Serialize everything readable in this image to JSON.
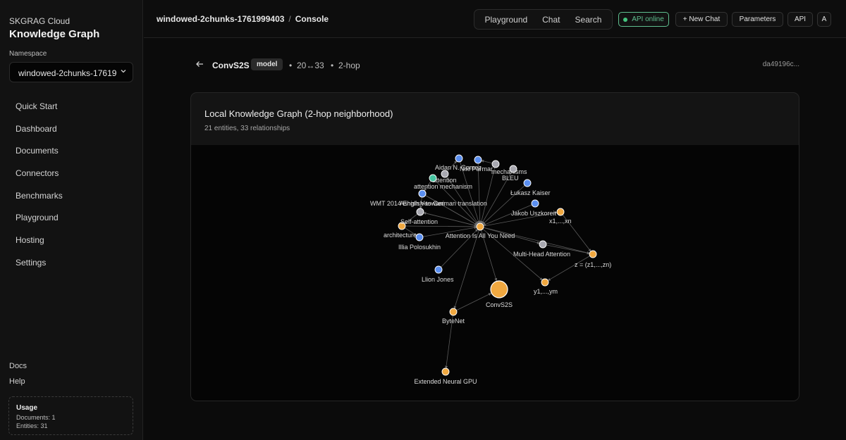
{
  "sidebar": {
    "brand_sub": "SKGRAG Cloud",
    "brand_title": "Knowledge Graph",
    "namespace_label": "Namespace",
    "namespace_value": "windowed-2chunks-1761999403",
    "nav": [
      "Quick Start",
      "Dashboard",
      "Documents",
      "Connectors",
      "Benchmarks",
      "Playground",
      "Hosting",
      "Settings"
    ],
    "footer_links": [
      "Docs",
      "Help"
    ],
    "usage": {
      "title": "Usage",
      "documents": "Documents: 1",
      "entities": "Entities: 31"
    }
  },
  "header": {
    "crumb_namespace": "windowed-2chunks-1761999403",
    "crumb_sep": "/",
    "crumb_page": "Console",
    "modes": [
      "Playground",
      "Chat",
      "Search"
    ],
    "api_status": "API online",
    "new_chat": "+ New Chat",
    "parameters": "Parameters",
    "api": "API",
    "avatar": "A",
    "status_color": "#45c47f"
  },
  "entity": {
    "name": "ConvS2S",
    "type_badge": "model",
    "counts": "20↔33",
    "hops": "2-hop",
    "id_short": "da49196c..."
  },
  "graph_card": {
    "title": "Local Knowledge Graph (2-hop neighborhood)",
    "subtitle": "21 entities, 33 relationships"
  },
  "graph": {
    "colors": {
      "orange": "#f0a840",
      "blue": "#5b8ff0",
      "gray": "#a8a8b0",
      "teal": "#45c4a0"
    },
    "nodes": [
      {
        "id": "attn",
        "label": "Attention Is All You Need",
        "color": "orange"
      },
      {
        "id": "conv",
        "label": "ConvS2S",
        "color": "orange",
        "focus": true
      },
      {
        "id": "bytenet",
        "label": "ByteNet",
        "color": "orange"
      },
      {
        "id": "engpu",
        "label": "Extended Neural GPU",
        "color": "orange"
      },
      {
        "id": "arch",
        "label": "architectures",
        "color": "orange"
      },
      {
        "id": "x1",
        "label": "x1,...,xn",
        "color": "orange"
      },
      {
        "id": "z",
        "label": "z = (z1,...,zn)",
        "color": "orange"
      },
      {
        "id": "y1",
        "label": "y1,...,ym",
        "color": "orange"
      },
      {
        "id": "mha",
        "label": "Multi-Head Attention",
        "color": "gray"
      },
      {
        "id": "selfatt",
        "label": "Self-attention",
        "color": "gray"
      },
      {
        "id": "mech",
        "label": "mechanisms",
        "color": "gray"
      },
      {
        "id": "attention",
        "label": "attention",
        "color": "gray"
      },
      {
        "id": "bleu",
        "label": "BLEU",
        "color": "gray"
      },
      {
        "id": "aidan",
        "label": "Aidan N. Gomez",
        "color": "blue"
      },
      {
        "id": "niki",
        "label": "Niki Parmar",
        "color": "blue"
      },
      {
        "id": "lukasz",
        "label": "Łukasz Kaiser",
        "color": "blue"
      },
      {
        "id": "jakob",
        "label": "Jakob Uszkoreit",
        "color": "blue"
      },
      {
        "id": "ashish",
        "label": "Ashish Vaswani",
        "color": "blue"
      },
      {
        "id": "illia",
        "label": "Illia Polosukhin",
        "color": "blue"
      },
      {
        "id": "llion",
        "label": "Llion Jones",
        "color": "blue"
      },
      {
        "id": "wmt",
        "label": "WMT 2014 English-to-German translation",
        "color": "blue"
      },
      {
        "id": "attmech",
        "label": "attention mechanism",
        "color": "teal"
      }
    ],
    "edges": [
      [
        "aidan",
        "attn"
      ],
      [
        "niki",
        "attn"
      ],
      [
        "lukasz",
        "attn"
      ],
      [
        "jakob",
        "attn"
      ],
      [
        "ashish",
        "attn"
      ],
      [
        "illia",
        "attn"
      ],
      [
        "llion",
        "attn"
      ],
      [
        "wmt",
        "attn"
      ],
      [
        "attmech",
        "attn"
      ],
      [
        "mech",
        "attn"
      ],
      [
        "attention",
        "attn"
      ],
      [
        "bleu",
        "attn"
      ],
      [
        "selfatt",
        "attn"
      ],
      [
        "arch",
        "attn"
      ],
      [
        "attn",
        "conv"
      ],
      [
        "attn",
        "bytenet"
      ],
      [
        "attn",
        "mha"
      ],
      [
        "attn",
        "y1"
      ],
      [
        "attn",
        "z"
      ],
      [
        "attn",
        "x1"
      ],
      [
        "mha",
        "z"
      ],
      [
        "x1",
        "z"
      ],
      [
        "z",
        "y1"
      ],
      [
        "bytenet",
        "conv"
      ],
      [
        "bytenet",
        "engpu"
      ],
      [
        "selfatt",
        "arch"
      ],
      [
        "arch",
        "illia"
      ],
      [
        "ashish",
        "selfatt"
      ],
      [
        "wmt",
        "ashish"
      ],
      [
        "attmech",
        "wmt"
      ],
      [
        "mech",
        "niki"
      ],
      [
        "attention",
        "aidan"
      ],
      [
        "attn",
        "selfatt"
      ]
    ]
  }
}
